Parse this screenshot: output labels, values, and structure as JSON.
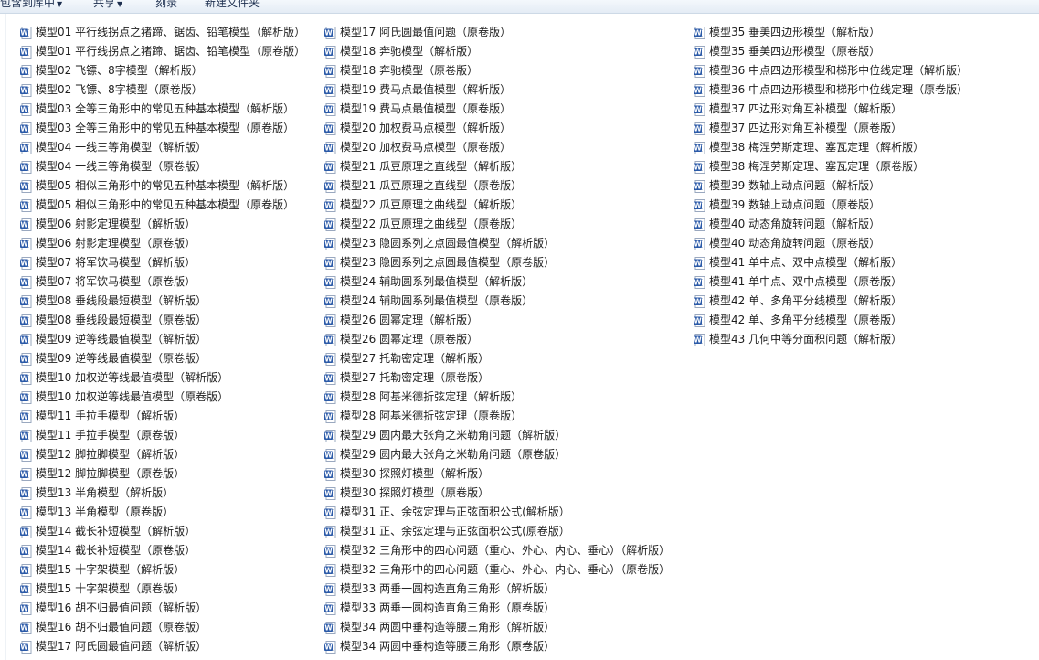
{
  "toolbar": {
    "include_in_library": "包含到库中",
    "share": "共享",
    "burn": "刻录",
    "new_folder": "新建文件夹"
  },
  "icon_type": "word-document-icon",
  "columns": [
    [
      "模型01 平行线拐点之猪蹄、锯齿、铅笔模型（解析版）",
      "模型01 平行线拐点之猪蹄、锯齿、铅笔模型（原卷版）",
      "模型02 飞镖、8字模型（解析版）",
      "模型02 飞镖、8字模型（原卷版）",
      "模型03 全等三角形中的常见五种基本模型（解析版）",
      "模型03 全等三角形中的常见五种基本模型（原卷版）",
      "模型04 一线三等角模型（解析版）",
      "模型04 一线三等角模型（原卷版）",
      "模型05 相似三角形中的常见五种基本模型（解析版）",
      "模型05 相似三角形中的常见五种基本模型（原卷版）",
      "模型06 射影定理模型（解析版）",
      "模型06 射影定理模型（原卷版）",
      "模型07 将军饮马模型（解析版）",
      "模型07 将军饮马模型（原卷版）",
      "模型08 垂线段最短模型（解析版）",
      "模型08 垂线段最短模型（原卷版）",
      "模型09 逆等线最值模型（解析版）",
      "模型09 逆等线最值模型（原卷版）",
      "模型10 加权逆等线最值模型（解析版）",
      "模型10 加权逆等线最值模型（原卷版）",
      "模型11 手拉手模型（解析版）",
      "模型11 手拉手模型（原卷版）",
      "模型12 脚拉脚模型（解析版）",
      "模型12 脚拉脚模型（原卷版）",
      "模型13 半角模型（解析版）",
      "模型13 半角模型（原卷版）",
      "模型14 截长补短模型（解析版）",
      "模型14 截长补短模型（原卷版）",
      "模型15 十字架模型（解析版）",
      "模型15 十字架模型（原卷版）",
      "模型16 胡不归最值问题（解析版）",
      "模型16 胡不归最值问题（原卷版）",
      "模型17 阿氏圆最值问题（解析版）"
    ],
    [
      "模型17 阿氏圆最值问题（原卷版）",
      "模型18 奔驰模型（解析版）",
      "模型18 奔驰模型（原卷版）",
      "模型19 费马点最值模型（解析版）",
      "模型19 费马点最值模型（原卷版）",
      "模型20 加权费马点模型（解析版）",
      "模型20 加权费马点模型（原卷版）",
      "模型21 瓜豆原理之直线型（解析版）",
      "模型21 瓜豆原理之直线型（原卷版）",
      "模型22 瓜豆原理之曲线型（解析版）",
      "模型22 瓜豆原理之曲线型（原卷版）",
      "模型23 隐圆系列之点圆最值模型（解析版）",
      "模型23 隐圆系列之点圆最值模型（原卷版）",
      "模型24 辅助圆系列最值模型（解析版）",
      "模型24 辅助圆系列最值模型（原卷版）",
      "模型26 圆幂定理（解析版）",
      "模型26 圆幂定理（原卷版）",
      "模型27 托勒密定理（解析版）",
      "模型27 托勒密定理（原卷版）",
      "模型28 阿基米德折弦定理（解析版）",
      "模型28 阿基米德折弦定理（原卷版）",
      "模型29 圆内最大张角之米勒角问题（解析版）",
      "模型29 圆内最大张角之米勒角问题（原卷版）",
      "模型30 探照灯模型（解析版）",
      "模型30 探照灯模型（原卷版）",
      "模型31 正、余弦定理与正弦面积公式(解析版）",
      "模型31 正、余弦定理与正弦面积公式(原卷版）",
      "模型32 三角形中的四心问题（重心、外心、内心、垂心）（解析版）",
      "模型32 三角形中的四心问题（重心、外心、内心、垂心）（原卷版）",
      "模型33 两垂一圆构造直角三角形（解析版）",
      "模型33 两垂一圆构造直角三角形（原卷版）",
      "模型34 两圆中垂构造等腰三角形（解析版）",
      "模型34 两圆中垂构造等腰三角形（原卷版）"
    ],
    [
      "模型35 垂美四边形模型（解析版）",
      "模型35 垂美四边形模型（原卷版）",
      "模型36 中点四边形模型和梯形中位线定理（解析版）",
      "模型36 中点四边形模型和梯形中位线定理（原卷版）",
      "模型37 四边形对角互补模型（解析版）",
      "模型37 四边形对角互补模型（原卷版）",
      "模型38 梅涅劳斯定理、塞瓦定理（解析版）",
      "模型38 梅涅劳斯定理、塞瓦定理（原卷版）",
      "模型39 数轴上动点问题（解析版）",
      "模型39 数轴上动点问题（原卷版）",
      "模型40 动态角旋转问题（解析版）",
      "模型40 动态角旋转问题（原卷版）",
      "模型41 单中点、双中点模型（解析版）",
      "模型41 单中点、双中点模型（原卷版）",
      "模型42 单、多角平分线模型（解析版）",
      "模型42 单、多角平分线模型（原卷版）",
      "模型43 几何中等分面积问题（解析版）"
    ]
  ]
}
